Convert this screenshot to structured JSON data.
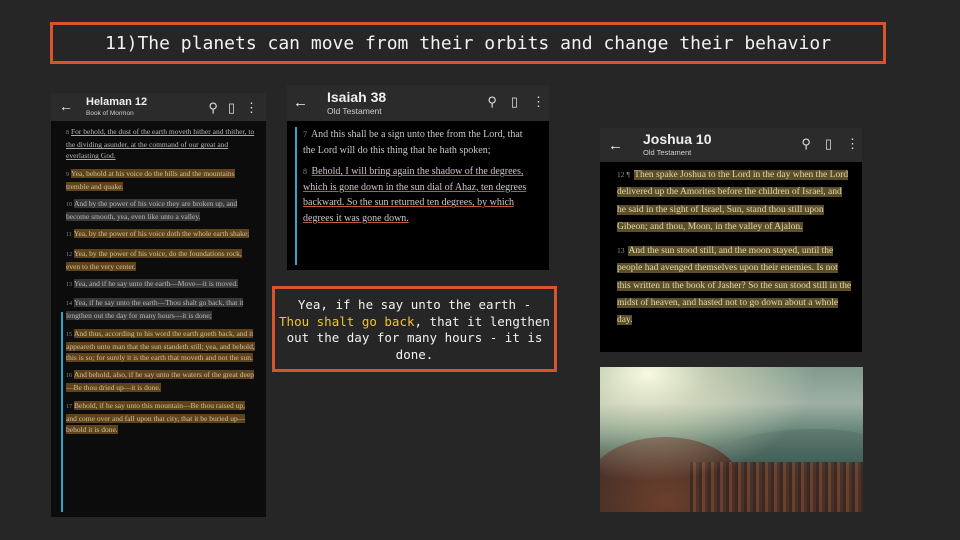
{
  "slide": {
    "title": "11)The planets can move from their orbits and change their behavior",
    "quote": {
      "before": "Yea, if he say unto the earth -",
      "highlight": "Thou shalt go back",
      "after": ", that it lengthen out the day for many hours - it is done."
    }
  },
  "helaman": {
    "title": "Helaman 12",
    "subtitle": "Book of Mormon",
    "verses": [
      {
        "n": "8",
        "t": "For behold, the dust of the earth moveth hither and thither, to the dividing asunder, at the command of our great and everlasting God."
      },
      {
        "n": "9",
        "t": "Yea, behold at his voice do the hills and the mountains tremble and quake."
      },
      {
        "n": "10",
        "t": "And by the power of his voice they are broken up, and become smooth, yea, even like unto a valley."
      },
      {
        "n": "11",
        "t": "Yea, by the power of his voice doth the whole earth shake;"
      },
      {
        "n": "12",
        "t": "Yea, by the power of his voice, do the foundations rock, even to the very center."
      },
      {
        "n": "13",
        "t": "Yea, and if he say unto the earth—Move—it is moved."
      },
      {
        "n": "14",
        "t": "Yea, if he say unto the earth—Thou shalt go back, that it lengthen out the day for many hours—it is done;"
      },
      {
        "n": "15",
        "t": "And thus, according to his word the earth goeth back, and it appeareth unto man that the sun standeth still; yea, and behold, this is so; for surely it is the earth that moveth and not the sun."
      },
      {
        "n": "16",
        "t": "And behold, also, if he say unto the waters of the great deep—Be thou dried up—it is done."
      },
      {
        "n": "17",
        "t": "Behold, if he say unto this mountain—Be thou raised up, and come over and fall upon that city, that it be buried up—behold it is done."
      }
    ]
  },
  "isaiah": {
    "title": "Isaiah 38",
    "subtitle": "Old Testament",
    "verses": [
      {
        "n": "7",
        "t": "And this shall be a sign unto thee from the Lord, that the Lord will do this thing that he hath spoken;"
      },
      {
        "n": "8",
        "t": "Behold, I will bring again the shadow of the degrees, which is gone down in the sun dial of Ahaz, ten degrees backward. So the sun returned ten degrees, by which degrees it was gone down."
      }
    ]
  },
  "joshua": {
    "title": "Joshua 10",
    "subtitle": "Old Testament",
    "verses": [
      {
        "n": "12 ¶",
        "t": "Then spake Joshua to the Lord in the day when the Lord delivered up the Amorites before the children of Israel, and he said in the sight of Israel, Sun, stand thou still upon Gibeon; and thou, Moon, in the valley of Ajalon."
      },
      {
        "n": "13",
        "t": "And the sun stood still, and the moon stayed, until the people had avenged themselves upon their enemies. Is not this written in the book of Jasher? So the sun stood still in the midst of heaven, and hasted not to go down about a whole day."
      }
    ]
  },
  "icons": [
    "back-arrow-icon",
    "search-icon",
    "bookmark-icon",
    "more-vert-icon"
  ],
  "colors": {
    "accent_border": "#d9532c",
    "quote_highlight": "#f1c232",
    "verse_bar": "#2fa6c9"
  }
}
